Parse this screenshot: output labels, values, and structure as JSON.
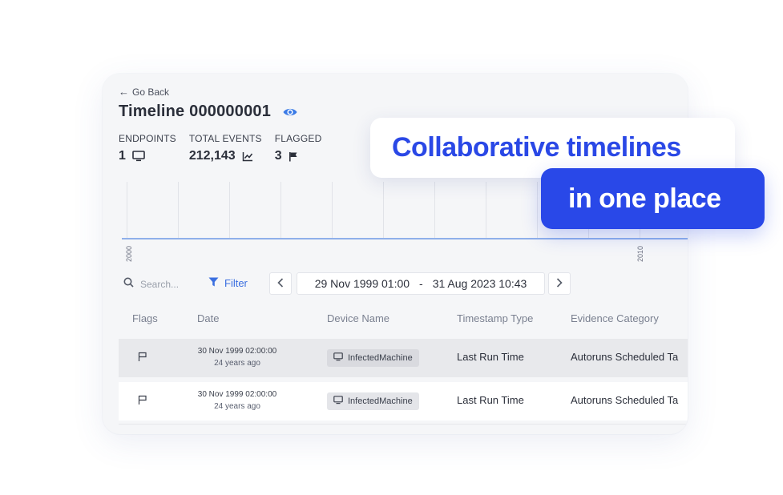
{
  "header": {
    "go_back": "Go Back",
    "title": "Timeline 000000001"
  },
  "stats": {
    "endpoints_label": "ENDPOINTS",
    "endpoints_value": "1",
    "total_events_label": "TOTAL EVENTS",
    "total_events_value": "212,143",
    "flagged_label": "FLAGGED",
    "flagged_value": "3"
  },
  "timeline": {
    "year_start": "2000",
    "year_end": "2010"
  },
  "toolbar": {
    "search_placeholder": "Search...",
    "filter_label": "Filter",
    "date_from": "29 Nov 1999 01:00",
    "date_separator": "-",
    "date_to": "31 Aug 2023 10:43"
  },
  "table": {
    "columns": [
      "Flags",
      "Date",
      "Device Name",
      "Timestamp Type",
      "Evidence Category"
    ],
    "rows": [
      {
        "date": "30 Nov 1999 02:00:00",
        "relative": "24 years ago",
        "device": "InfectedMachine",
        "timestamp_type": "Last Run Time",
        "evidence_category": "Autoruns Scheduled Ta"
      },
      {
        "date": "30 Nov 1999 02:00:00",
        "relative": "24 years ago",
        "device": "InfectedMachine",
        "timestamp_type": "Last Run Time",
        "evidence_category": "Autoruns Scheduled Ta"
      }
    ]
  },
  "callouts": {
    "line1": "Collaborative timelines",
    "line2": "in one place"
  },
  "colors": {
    "accent": "#2948e8",
    "accent_text": "#2a48e6",
    "filter_blue": "#3b6fe0",
    "axis_blue": "#8fb0ea"
  },
  "icons": {
    "back": "arrow-left-icon",
    "visibility": "eye-icon",
    "endpoints": "monitor-icon",
    "events": "line-chart-icon",
    "flagged": "flag-icon",
    "search": "search-icon",
    "filter": "funnel-icon",
    "prev": "chevron-left-icon",
    "next": "chevron-right-icon",
    "row_flag": "flag-outline-icon",
    "device": "monitor-icon"
  }
}
